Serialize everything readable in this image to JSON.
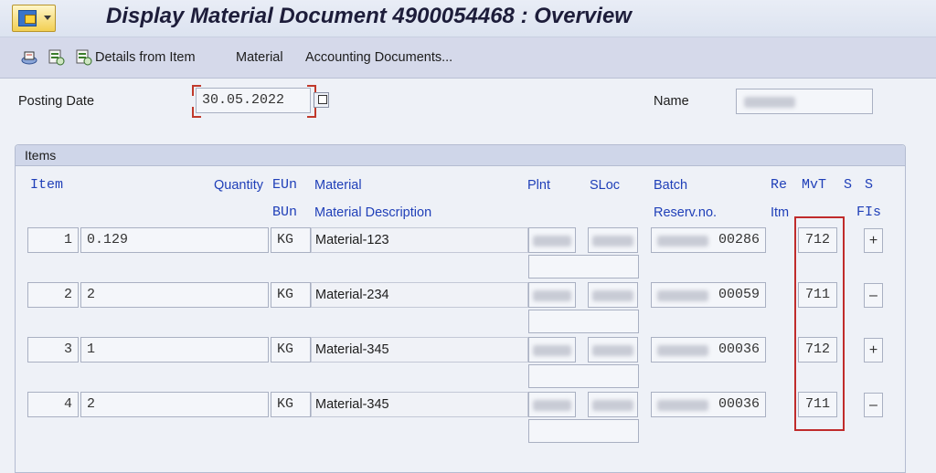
{
  "window": {
    "title": "Display Material Document 4900054468 : Overview"
  },
  "toolbar": {
    "icons": [
      "other-document-icon",
      "display-icon",
      "details-icon"
    ],
    "details_label": "Details from Item",
    "material_label": "Material",
    "accounting_label": "Accounting Documents..."
  },
  "header": {
    "posting_date_label": "Posting Date",
    "posting_date_value": "30.05.2022",
    "name_label": "Name"
  },
  "items": {
    "section_title": "Items",
    "columns": {
      "item": "Item",
      "quantity": "Quantity",
      "eun": "EUn",
      "material": "Material",
      "plnt": "Plnt",
      "sloc": "SLoc",
      "batch": "Batch",
      "re": "Re",
      "mvt": "MvT",
      "s1": "S",
      "s2": "S",
      "bun": "BUn",
      "material_description": "Material Description",
      "reserv_no": "Reserv.no.",
      "itm": "Itm",
      "fis": "FIs"
    },
    "rows": [
      {
        "item": "1",
        "quantity": "0.129",
        "unit": "KG",
        "material": "Material-123",
        "reserv_suffix": "00286",
        "mvt": "712",
        "sign": "+"
      },
      {
        "item": "2",
        "quantity": "2",
        "unit": "KG",
        "material": "Material-234",
        "reserv_suffix": "00059",
        "mvt": "711",
        "sign": "–"
      },
      {
        "item": "3",
        "quantity": "1",
        "unit": "KG",
        "material": "Material-345",
        "reserv_suffix": "00036",
        "mvt": "712",
        "sign": "+"
      },
      {
        "item": "4",
        "quantity": "2",
        "unit": "KG",
        "material": "Material-345",
        "reserv_suffix": "00036",
        "mvt": "711",
        "sign": "–"
      }
    ]
  },
  "colors": {
    "highlight": "#c02b2b",
    "column_header": "#1f3fb8"
  }
}
